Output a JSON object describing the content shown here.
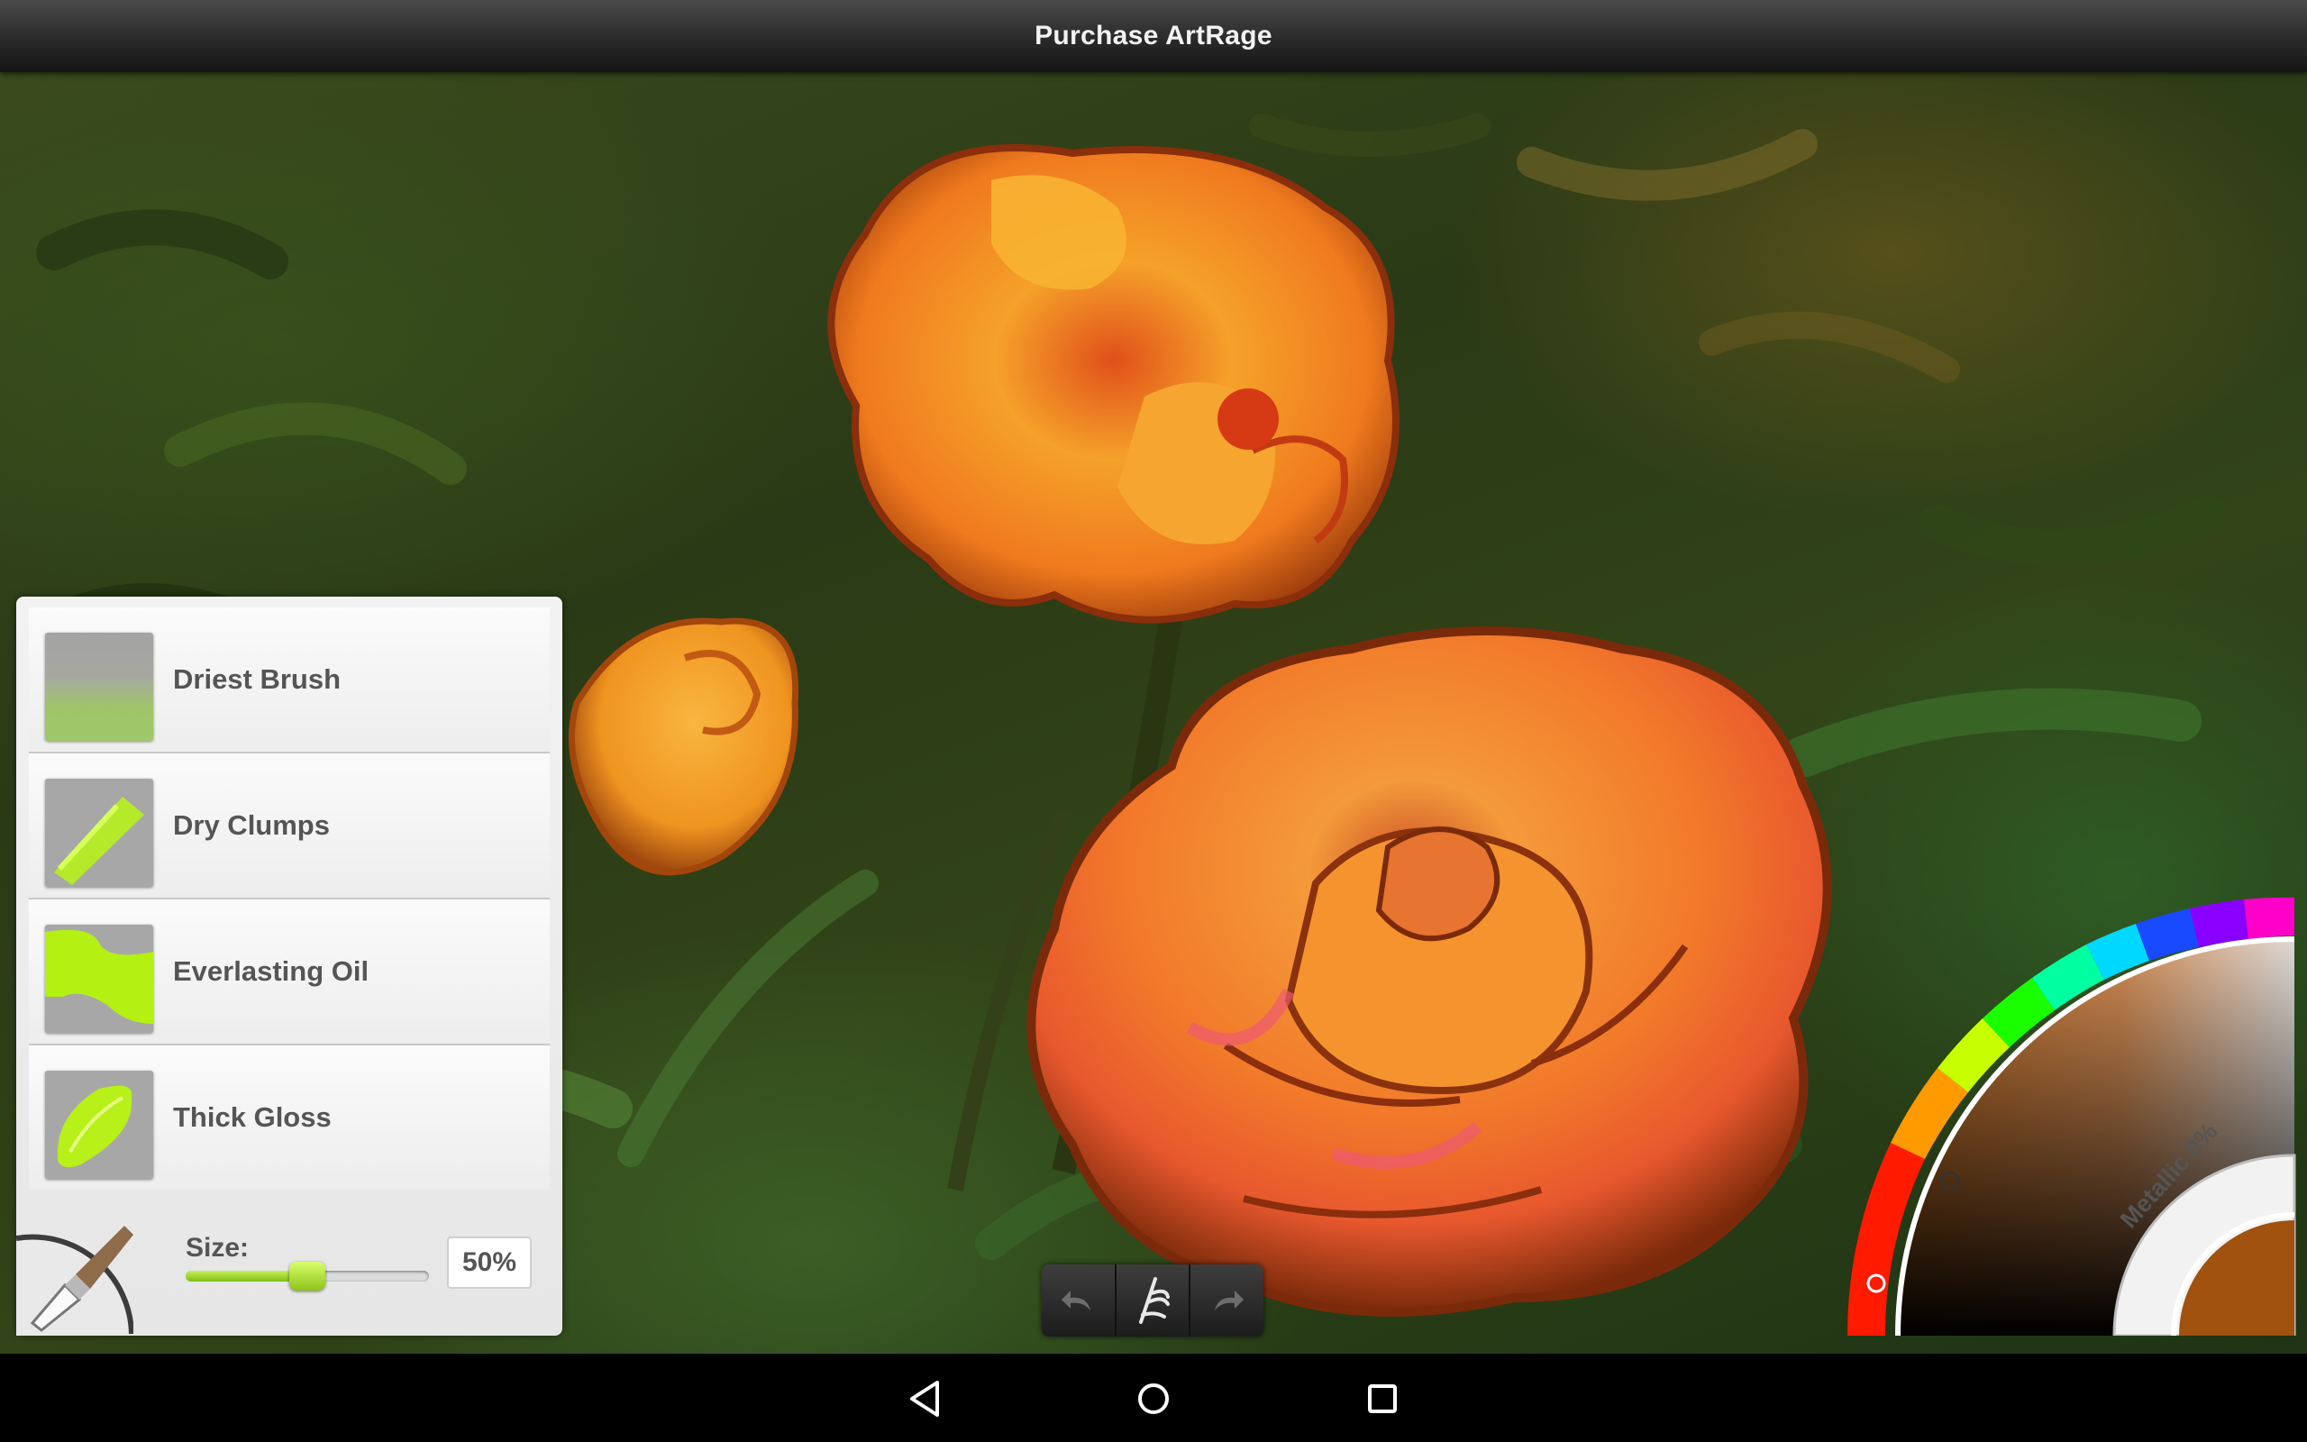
{
  "title": "Purchase ArtRage",
  "presets": [
    {
      "label": "Driest Brush"
    },
    {
      "label": "Dry Clumps"
    },
    {
      "label": "Everlasting Oil"
    },
    {
      "label": "Thick Gloss"
    }
  ],
  "size": {
    "label": "Size:",
    "value_text": "50%",
    "value": 0.5
  },
  "toolbar": {
    "undo": "undo-icon",
    "tool": "artrage-logo-icon",
    "redo": "redo-icon"
  },
  "color_picker": {
    "metallic_label": "Metallic 0%",
    "current_color": "#a0520e"
  },
  "nav": {
    "back": "back-icon",
    "home": "home-icon",
    "recents": "recents-icon"
  },
  "colors": {
    "accent": "#9edb1a",
    "panel": "#eeeeee"
  }
}
